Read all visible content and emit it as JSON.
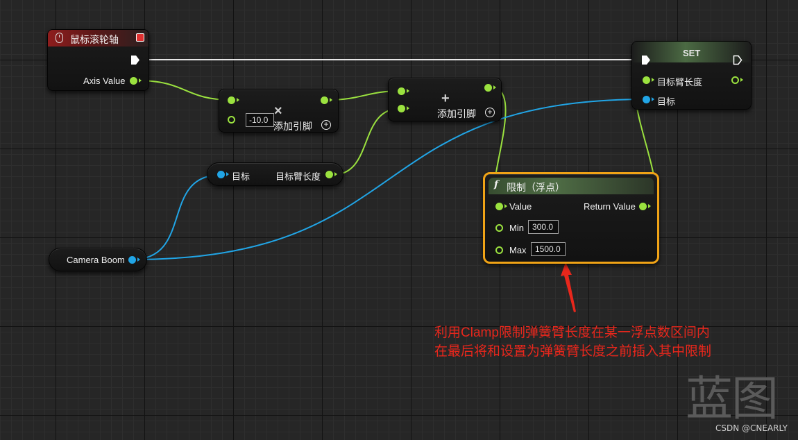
{
  "colors": {
    "float_pin": "#9be23f",
    "object_pin": "#21a5e6",
    "exec_pin": "#ffffff",
    "selection": "#f0a316",
    "annotation": "#e8271c"
  },
  "event_node": {
    "title": "鼠标滚轮轴",
    "icon": "mouse-icon",
    "output_label": "Axis Value"
  },
  "multiply_node": {
    "symbol": "×",
    "default_value": "-10.0",
    "add_pin_label": "添加引脚",
    "add_pin_icon": "plus-circle-icon"
  },
  "add_node": {
    "symbol": "+",
    "add_pin_label": "添加引脚",
    "add_pin_icon": "plus-circle-icon"
  },
  "get_node": {
    "input_label": "目标",
    "output_label": "目标臂长度"
  },
  "camera_node": {
    "label": "Camera Boom"
  },
  "set_node": {
    "title": "SET",
    "input_label": "目标臂长度",
    "target_label": "目标"
  },
  "clamp_node": {
    "icon": "function-icon",
    "icon_glyph": "f",
    "title": "限制（浮点）",
    "value_label": "Value",
    "return_label": "Return Value",
    "min_label": "Min",
    "min_value": "300.0",
    "max_label": "Max",
    "max_value": "1500.0"
  },
  "annotation": {
    "line1": "利用Clamp限制弹簧臂长度在某一浮点数区间内",
    "line2": "在最后将和设置为弹簧臂长度之前插入其中限制"
  },
  "watermark": {
    "glyphs": "蓝图",
    "credit": "CSDN @CNEARLY"
  }
}
